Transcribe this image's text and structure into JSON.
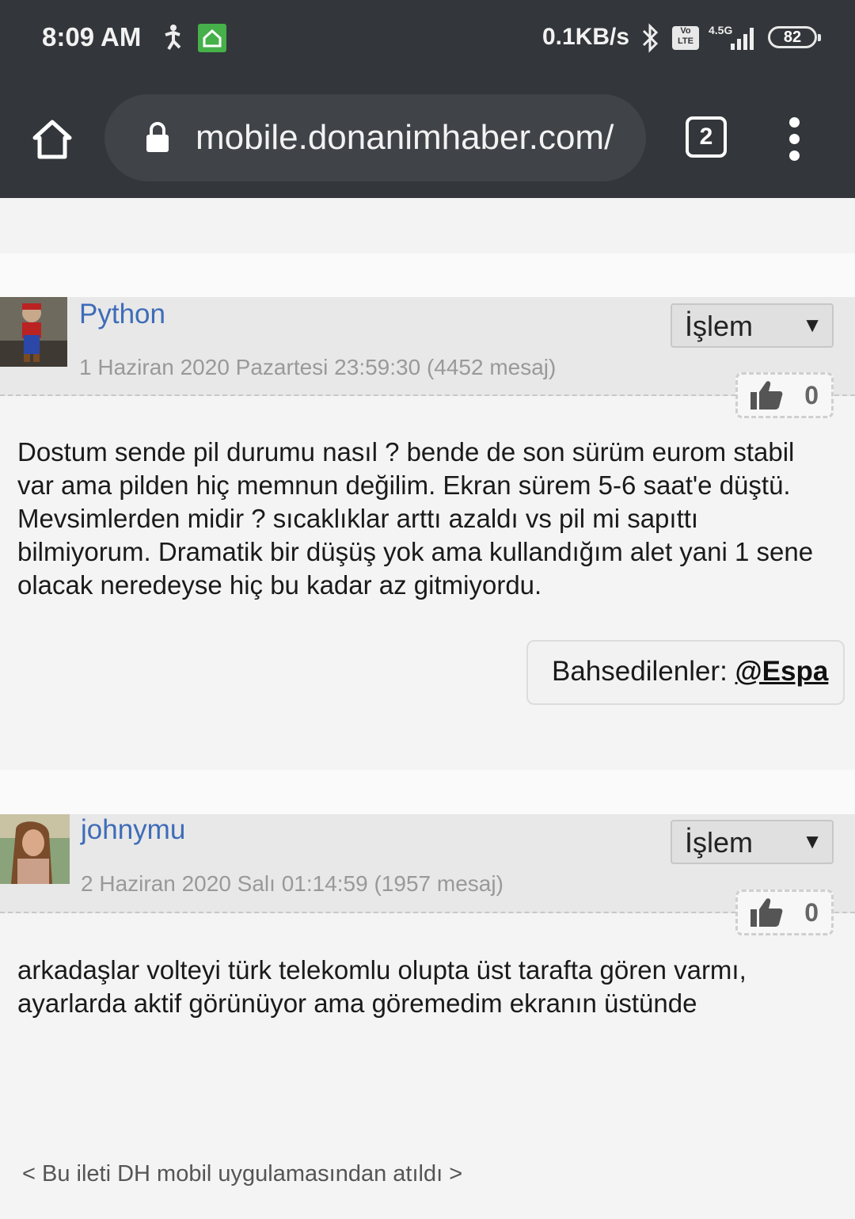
{
  "status_bar": {
    "time": "8:09 AM",
    "network_speed": "0.1KB/s",
    "volte": "Vo LTE",
    "network_type": "4.5G",
    "battery": "82"
  },
  "browser": {
    "url": "mobile.donanimhaber.com/",
    "tab_count": "2"
  },
  "posts": [
    {
      "username": "Python",
      "meta": "1 Haziran 2020 Pazartesi 23:59:30 (4452 mesaj)",
      "action_label": "İşlem",
      "action_arrow": "▼",
      "likes": "0",
      "content": "Dostum sende pil durumu nasıl ? bende de son sürüm eurom stabil var ama pilden hiç memnun değilim. Ekran sürem 5-6 saat'e düştü. Mevsimlerden midir ? sıcaklıklar arttı azaldı vs pil mi sapıttı bilmiyorum. Dramatik bir düşüş yok ama kullandığım alet yani 1 sene olacak neredeyse hiç bu kadar az gitmiyordu.",
      "mentions_label": "Bahsedilenler: ",
      "mention_user": "@Espa"
    },
    {
      "username": "johnymu",
      "meta": "2 Haziran 2020 Salı 01:14:59 (1957 mesaj)",
      "action_label": "İşlem",
      "action_arrow": "▼",
      "likes": "0",
      "content": "arkadaşlar volteyi türk telekomlu olupta üst tarafta gören varmı, ayarlarda aktif görünüyor ama göremedim ekranın üstünde",
      "footer": "< Bu ileti DH mobil uygulamasından atıldı >"
    }
  ],
  "colors": {
    "chrome_bg": "#33363a",
    "username": "#3e6cb8"
  }
}
